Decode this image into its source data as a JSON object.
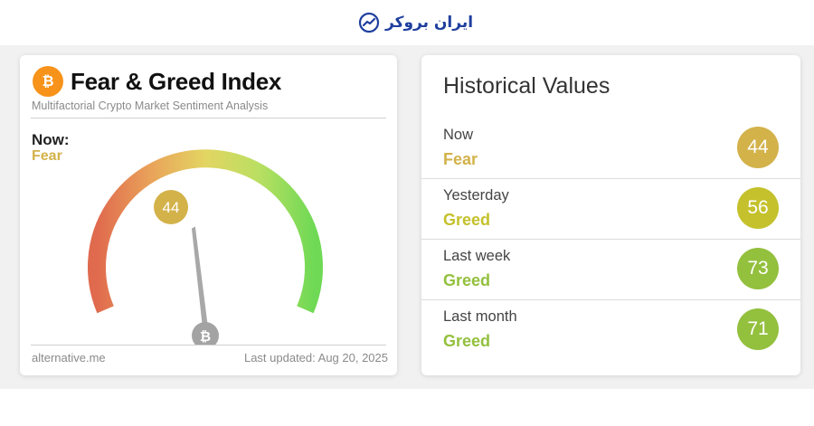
{
  "brand": {
    "name": "ایران بروکر"
  },
  "fear_greed": {
    "title": "Fear & Greed Index",
    "subtitle": "Multifactorial Crypto Market Sentiment Analysis",
    "now_label": "Now:",
    "now_value": "44",
    "now_classification": "Fear",
    "gauge_value": 44,
    "gauge_range": [
      0,
      100
    ],
    "source": "alternative.me",
    "last_updated": "Last updated: Aug 20, 2025",
    "icon": "bitcoin-icon"
  },
  "historical": {
    "title": "Historical Values",
    "items": [
      {
        "label": "Now",
        "classification": "Fear",
        "value": "44",
        "color": "#d3b24a"
      },
      {
        "label": "Yesterday",
        "classification": "Greed",
        "value": "56",
        "color": "#c4c12c"
      },
      {
        "label": "Last week",
        "classification": "Greed",
        "value": "73",
        "color": "#93c03d"
      },
      {
        "label": "Last month",
        "classification": "Greed",
        "value": "71",
        "color": "#93c03d"
      }
    ]
  },
  "colors": {
    "fear": "#d3b24a",
    "greed": "#93c03d",
    "bitcoin": "#f7931a",
    "brand": "#1f3f9e"
  }
}
